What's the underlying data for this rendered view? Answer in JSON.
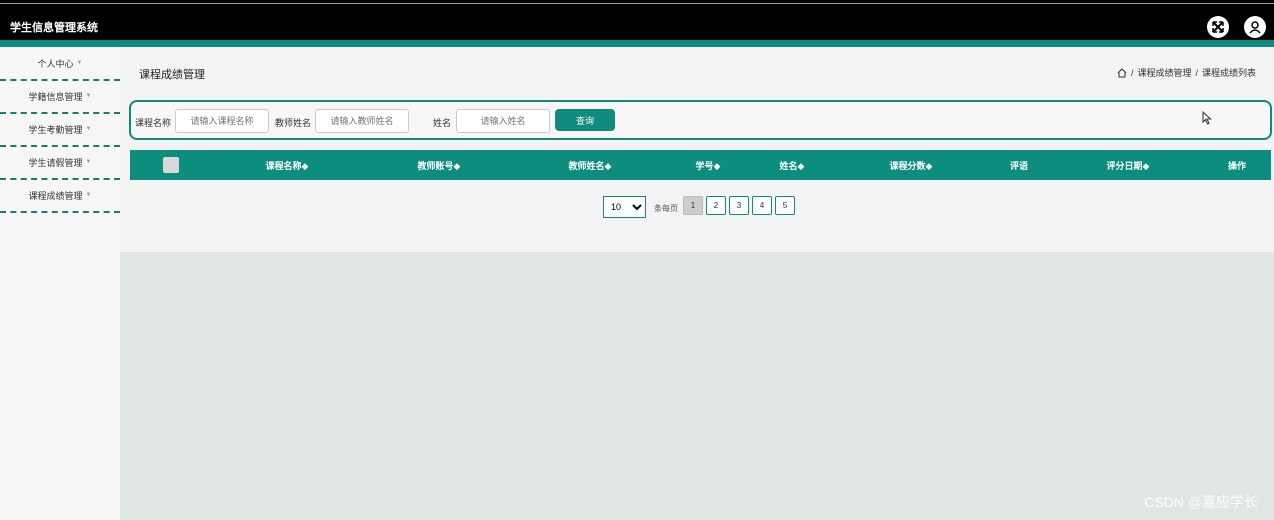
{
  "app": {
    "title": "学生信息管理系统"
  },
  "header": {
    "fullscreen_icon": "expand-arrows-icon",
    "user_icon": "user-icon"
  },
  "sidebar": {
    "items": [
      {
        "label": "个人中心"
      },
      {
        "label": "学籍信息管理"
      },
      {
        "label": "学生考勤管理"
      },
      {
        "label": "学生请假管理"
      },
      {
        "label": "课程成绩管理"
      }
    ]
  },
  "page": {
    "title": "课程成绩管理"
  },
  "breadcrumb": {
    "home_icon": "home-icon",
    "sep": "/",
    "level1": "课程成绩管理",
    "level2": "课程成绩列表"
  },
  "search": {
    "course_label": "课程名称",
    "course_placeholder": "请输入课程名称",
    "teacher_label": "教师姓名",
    "teacher_placeholder": "请输入教师姓名",
    "name_label": "姓名",
    "name_placeholder": "请输入姓名",
    "button": "查询"
  },
  "table": {
    "columns": [
      "课程名称◆",
      "教师账号◆",
      "教师姓名◆",
      "学号◆",
      "姓名◆",
      "课程分数◆",
      "评语",
      "评分日期◆",
      "操作"
    ],
    "rows": []
  },
  "pagination": {
    "page_size": "10",
    "per_page_label": "条每页",
    "pages": [
      "1",
      "2",
      "3",
      "4",
      "5"
    ],
    "current": "1"
  },
  "watermark": "CSDN @嘉应学长",
  "colors": {
    "accent": "#0d8d7d",
    "topbar": "#000000"
  }
}
